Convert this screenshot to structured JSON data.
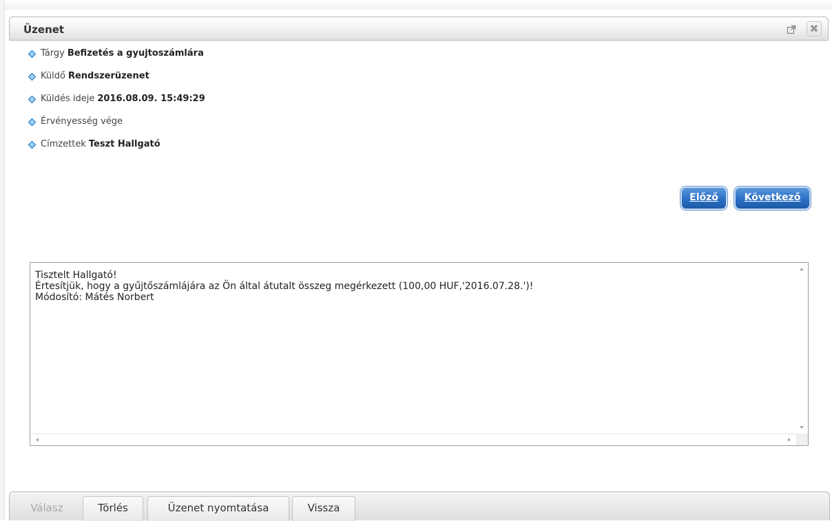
{
  "dialog": {
    "title": "Üzenet",
    "close_symbol": "✖",
    "icons": {
      "popout": "external-window-icon",
      "close": "close-icon",
      "bullet": "diamond-bullet-icon"
    }
  },
  "fields": [
    {
      "label": "Tárgy",
      "value": "Befizetés a gyujtoszámlára"
    },
    {
      "label": "Küldő",
      "value": "Rendszerüzenet"
    },
    {
      "label": "Küldés ideje",
      "value": "2016.08.09. 15:49:29"
    },
    {
      "label": "Érvényesség vége",
      "value": ""
    },
    {
      "label": "Címzettek",
      "value": "Teszt Hallgató"
    }
  ],
  "navigation": {
    "previous": "Előző",
    "next": "Következő"
  },
  "message": {
    "line1": "Tisztelt Hallgató!",
    "line2": "Értesítjük, hogy a gyűjtőszámlájára az Ön által átutalt összeg megérkezett (100,00 HUF,'2016.07.28.')!",
    "line3": "Módosító: Mátés Norbert"
  },
  "footer": {
    "reply": "Válasz",
    "delete": "Törlés",
    "print": "Üzenet nyomtatása",
    "back": "Vissza"
  },
  "colors": {
    "accent_button": "#2a6fc4",
    "diamond_bullet": "#4a9ad8",
    "disabled_text": "#a9a9a9"
  }
}
